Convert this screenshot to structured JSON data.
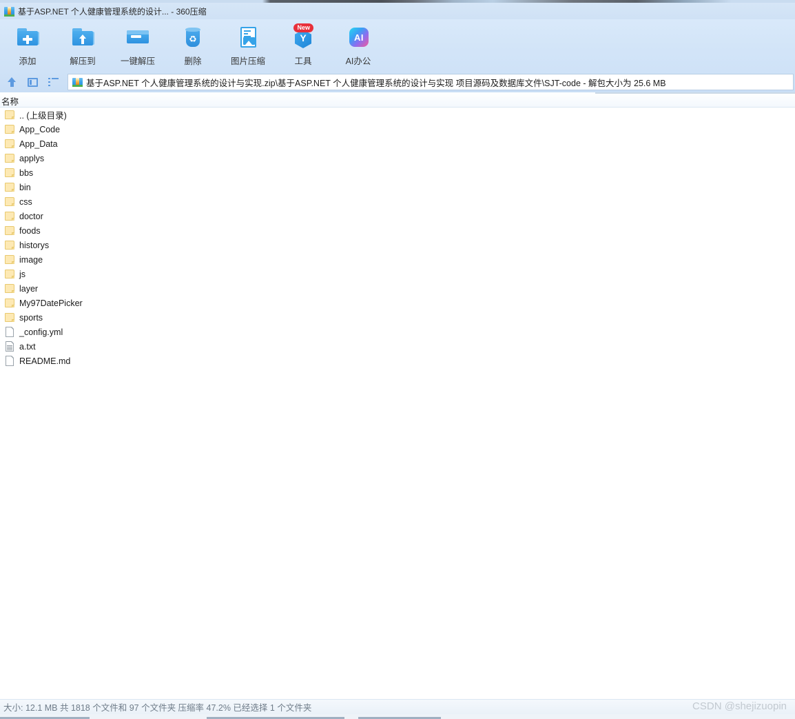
{
  "window": {
    "title": "基于ASP.NET 个人健康管理系统的设计... - 360压缩",
    "app_icon": "zip-archive-icon"
  },
  "toolbar": {
    "items": [
      {
        "label": "添加",
        "icon": "folder-add-icon",
        "badge": ""
      },
      {
        "label": "解压到",
        "icon": "folder-extract-icon",
        "badge": ""
      },
      {
        "label": "一键解压",
        "icon": "folder-oneclick-extract-icon",
        "badge": ""
      },
      {
        "label": "删除",
        "icon": "trash-recycle-icon",
        "badge": ""
      },
      {
        "label": "图片压缩",
        "icon": "image-compress-icon",
        "badge": ""
      },
      {
        "label": "工具",
        "icon": "tools-hexagon-icon",
        "badge": "New"
      },
      {
        "label": "AI办公",
        "icon": "ai-office-icon",
        "badge": ""
      }
    ]
  },
  "addressbar": {
    "nav": [
      {
        "name": "up-one-level-icon"
      },
      {
        "name": "panel-view-icon"
      },
      {
        "name": "list-view-icon"
      }
    ],
    "path": "基于ASP.NET 个人健康管理系统的设计与实现.zip\\基于ASP.NET 个人健康管理系统的设计与实现 项目源码及数据库文件\\SJT-code - 解包大小为 25.6 MB"
  },
  "list": {
    "columns": [
      "名称"
    ],
    "rows": [
      {
        "name": ".. (上级目录)",
        "type": "folder"
      },
      {
        "name": "App_Code",
        "type": "folder"
      },
      {
        "name": "App_Data",
        "type": "folder"
      },
      {
        "name": "applys",
        "type": "folder"
      },
      {
        "name": "bbs",
        "type": "folder"
      },
      {
        "name": "bin",
        "type": "folder"
      },
      {
        "name": "css",
        "type": "folder"
      },
      {
        "name": "doctor",
        "type": "folder"
      },
      {
        "name": "foods",
        "type": "folder"
      },
      {
        "name": "historys",
        "type": "folder"
      },
      {
        "name": "image",
        "type": "folder"
      },
      {
        "name": "js",
        "type": "folder"
      },
      {
        "name": "layer",
        "type": "folder"
      },
      {
        "name": "My97DatePicker",
        "type": "folder"
      },
      {
        "name": "sports",
        "type": "folder"
      },
      {
        "name": "_config.yml",
        "type": "file"
      },
      {
        "name": "a.txt",
        "type": "textfile"
      },
      {
        "name": "README.md",
        "type": "file"
      }
    ]
  },
  "statusbar": {
    "text": "大小: 12.1 MB 共 1818 个文件和 97 个文件夹 压缩率 47.2% 已经选择 1 个文件夹"
  },
  "watermark": {
    "text": "CSDN @shejizuopin"
  },
  "colors": {
    "toolbar_bg": "#d3e5f8",
    "titlebar_bg": "#d6e6f7",
    "accent_blue": "#2f93e0",
    "folder_yellow": "#fde9b4",
    "badge_red": "#e8303a"
  }
}
